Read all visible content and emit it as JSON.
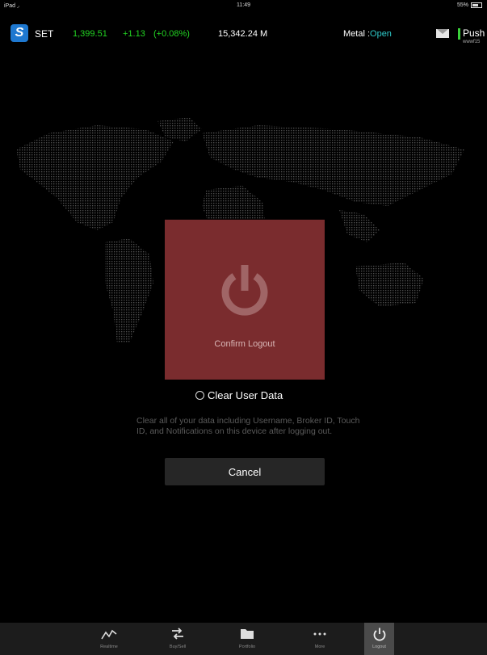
{
  "status_bar": {
    "device": "iPad",
    "time": "11:49",
    "battery": "55%",
    "battery_level": 0.55
  },
  "market": {
    "name": "SET",
    "index": "1,399.51",
    "change": "+1.13",
    "change_pct": "(+0.08%)",
    "volume": "15,342.24 M",
    "metal_label": "Metal :",
    "metal_status": "Open",
    "push_label": "Push",
    "push_user": "wwwf15"
  },
  "confirm": {
    "label": "Confirm Logout"
  },
  "clear_data": {
    "label": "Clear User Data",
    "description": "Clear all of your data including Username, Broker ID, Touch ID, and Notifications on this device after logging out."
  },
  "cancel": {
    "label": "Cancel"
  },
  "tabs": [
    {
      "label": "Realtime",
      "icon": "chart-line-icon"
    },
    {
      "label": "Buy/Sell",
      "icon": "arrows-swap-icon"
    },
    {
      "label": "Portfolio",
      "icon": "folder-icon"
    },
    {
      "label": "More",
      "icon": "ellipsis-icon"
    },
    {
      "label": "Logout",
      "icon": "power-icon",
      "active": true
    }
  ],
  "colors": {
    "up": "#22d322",
    "open": "#2ec9c9",
    "confirm_bg": "#7a2c2e",
    "tab_active": "#4a4a4a"
  }
}
